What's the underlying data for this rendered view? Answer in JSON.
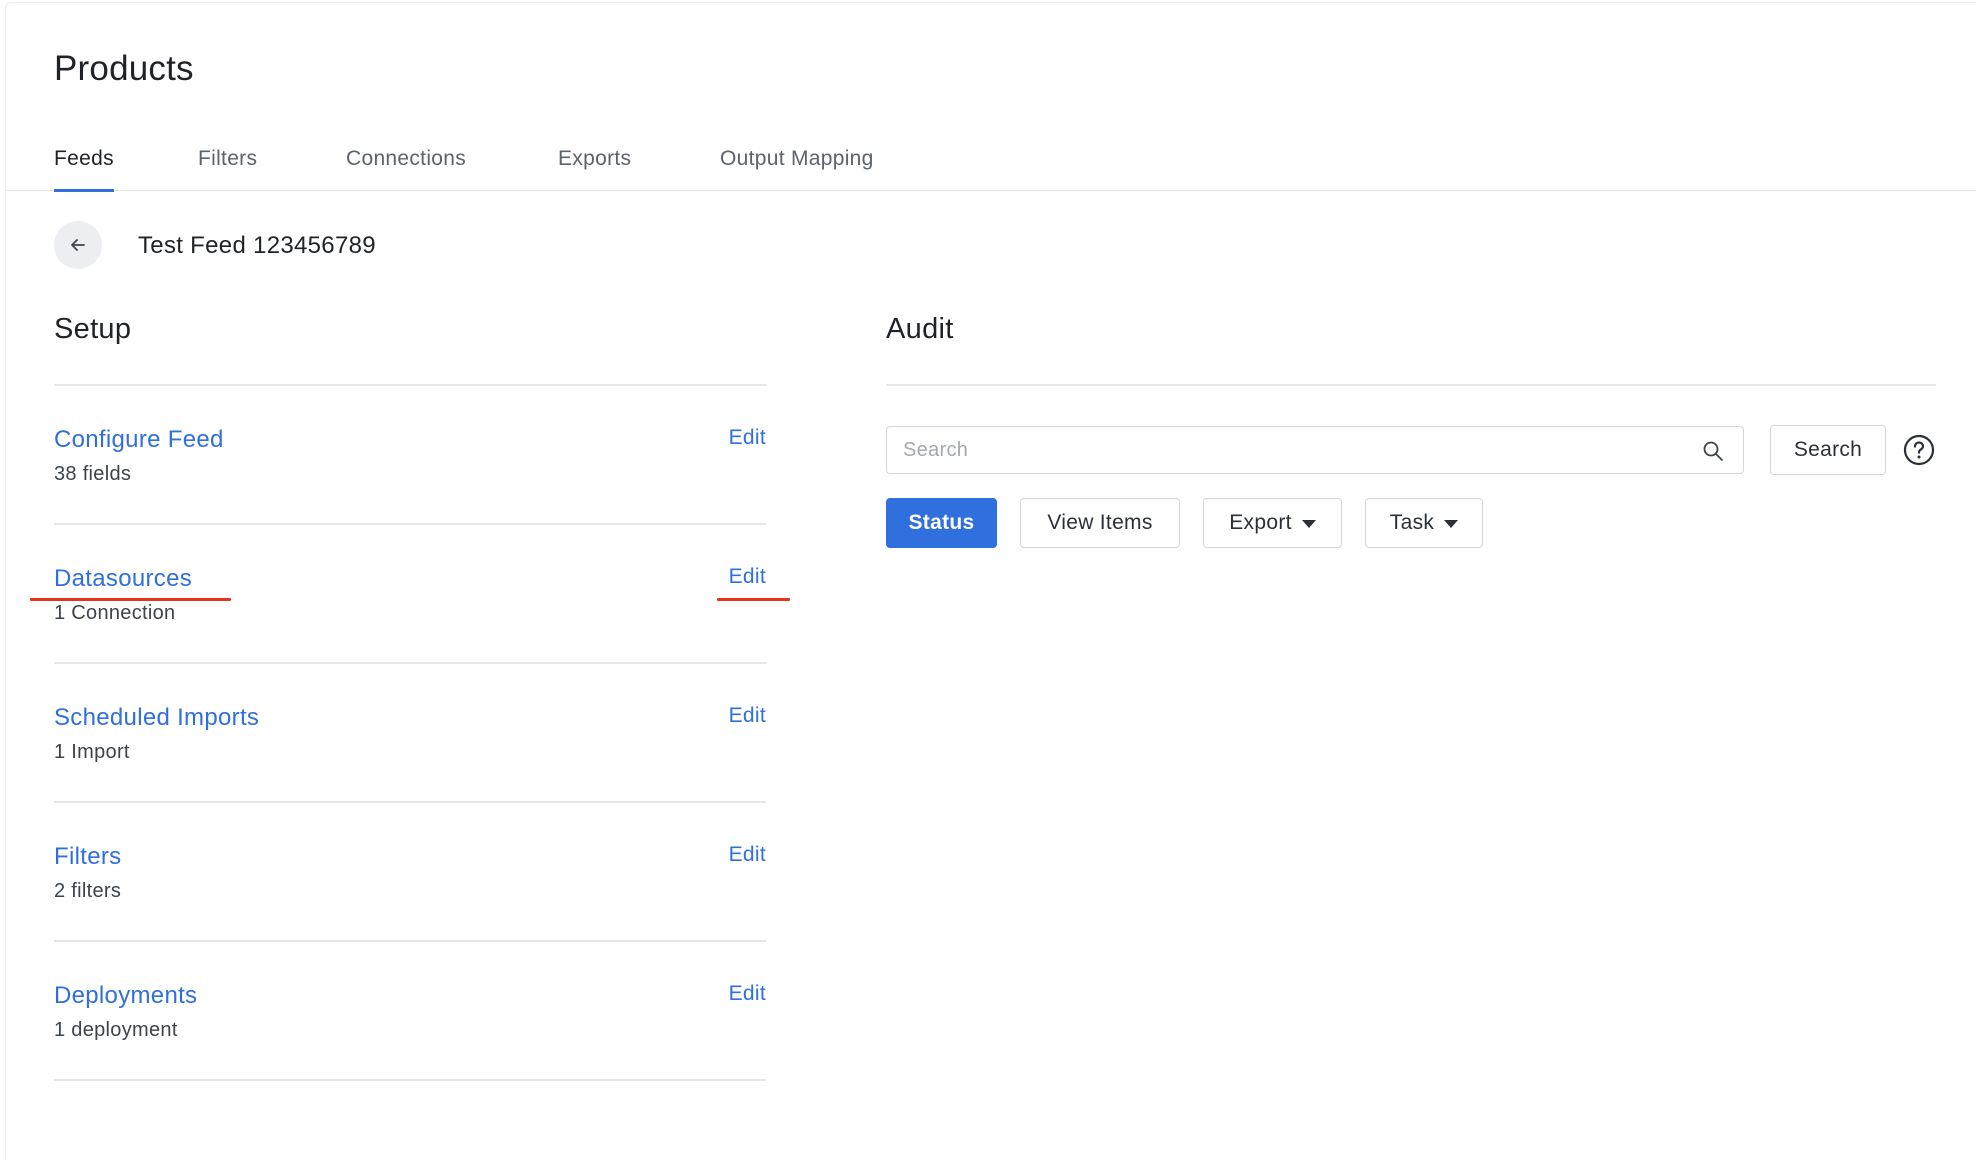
{
  "page": {
    "title": "Products"
  },
  "tabs": [
    {
      "label": "Feeds",
      "active": true
    },
    {
      "label": "Filters",
      "active": false
    },
    {
      "label": "Connections",
      "active": false
    },
    {
      "label": "Exports",
      "active": false
    },
    {
      "label": "Output Mapping",
      "active": false
    }
  ],
  "feed": {
    "name": "Test Feed 123456789"
  },
  "setup": {
    "title": "Setup",
    "rows": [
      {
        "title": "Configure Feed",
        "subtitle": "38 fields",
        "edit": "Edit"
      },
      {
        "title": "Datasources",
        "subtitle": "1 Connection",
        "edit": "Edit"
      },
      {
        "title": "Scheduled Imports",
        "subtitle": "1 Import",
        "edit": "Edit"
      },
      {
        "title": "Filters",
        "subtitle": "2 filters",
        "edit": "Edit"
      },
      {
        "title": "Deployments",
        "subtitle": "1 deployment",
        "edit": "Edit"
      }
    ]
  },
  "audit": {
    "title": "Audit",
    "search_placeholder": "Search",
    "search_button": "Search",
    "buttons": {
      "status": "Status",
      "view_items": "View Items",
      "export": "Export",
      "task": "Task"
    }
  },
  "icons": {
    "back": "arrow-left-icon",
    "search": "magnifier-icon",
    "help": "question-circle-icon",
    "dropdown": "caret-down-icon"
  },
  "colors": {
    "accent": "#2f6fde",
    "annotation": "#e5331e",
    "divider": "#e3e5e8"
  }
}
